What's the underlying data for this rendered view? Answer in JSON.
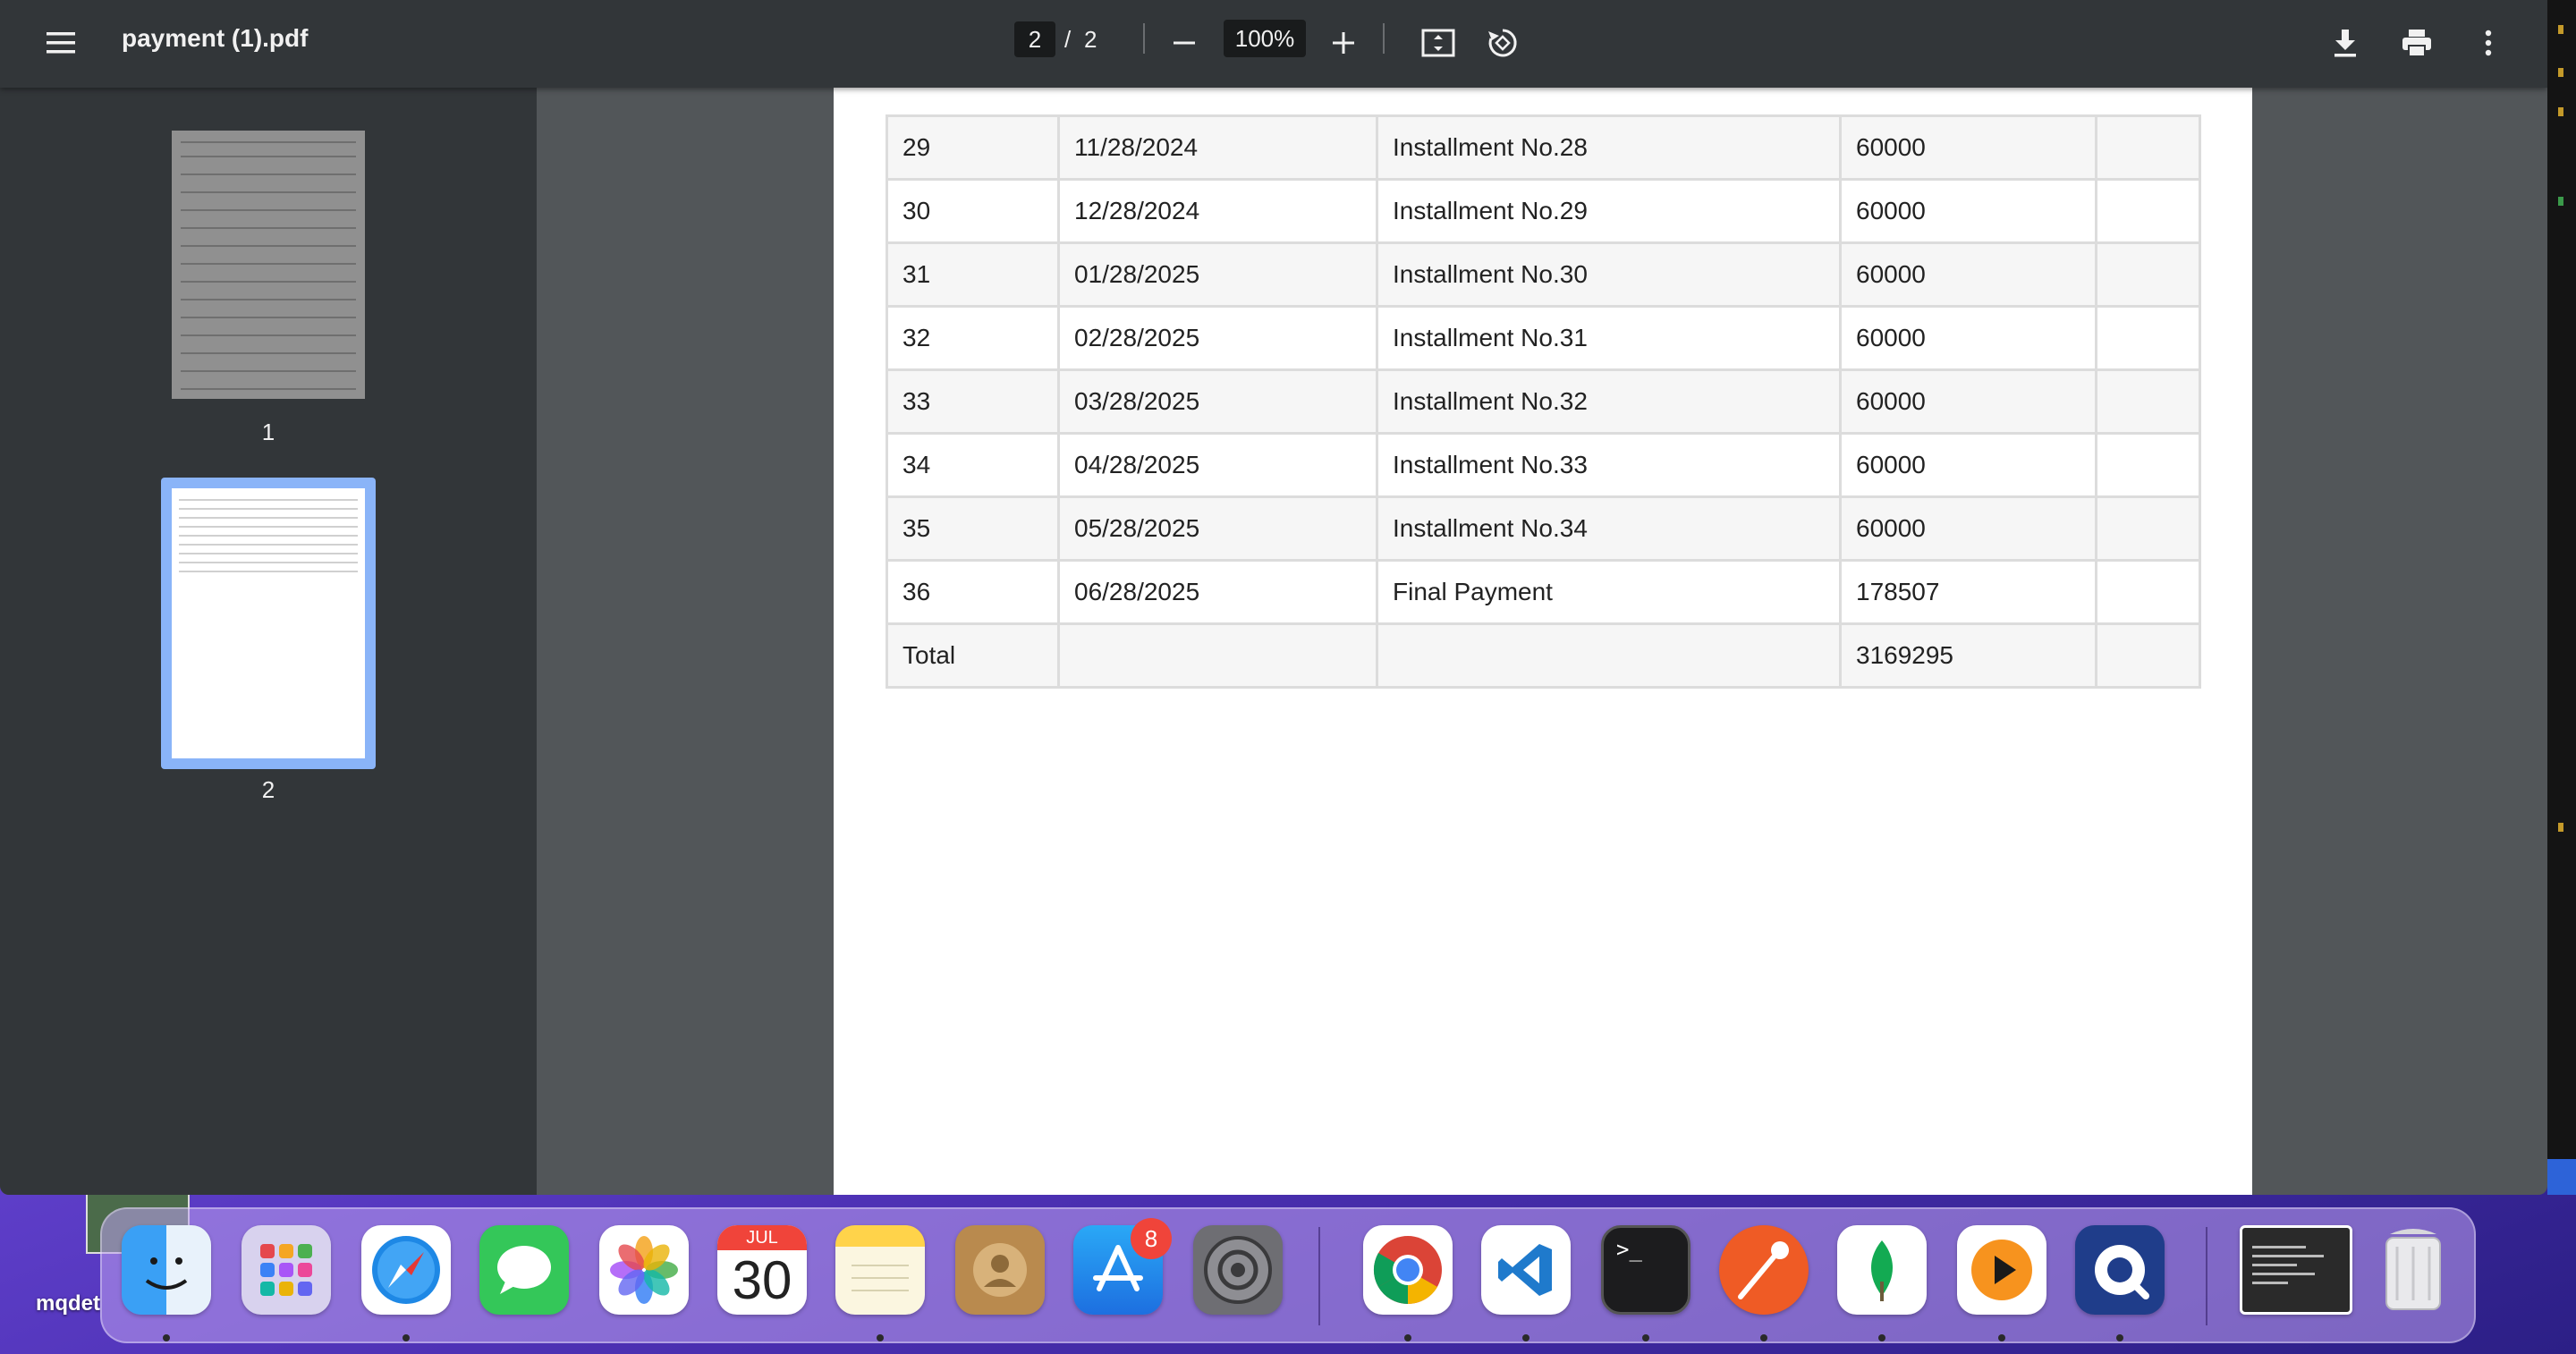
{
  "window": {
    "file_title": "payment (1).pdf",
    "current_page": "2",
    "page_separator": "/",
    "total_pages": "2",
    "zoom": "100%"
  },
  "sidebar": {
    "thumbnails": [
      {
        "label": "1",
        "selected": false
      },
      {
        "label": "2",
        "selected": true
      }
    ]
  },
  "table": {
    "rows": [
      {
        "no": "29",
        "date": "11/28/2024",
        "description": "Installment No.28",
        "amount": "60000",
        "extra": ""
      },
      {
        "no": "30",
        "date": "12/28/2024",
        "description": "Installment No.29",
        "amount": "60000",
        "extra": ""
      },
      {
        "no": "31",
        "date": "01/28/2025",
        "description": "Installment No.30",
        "amount": "60000",
        "extra": ""
      },
      {
        "no": "32",
        "date": "02/28/2025",
        "description": "Installment No.31",
        "amount": "60000",
        "extra": ""
      },
      {
        "no": "33",
        "date": "03/28/2025",
        "description": "Installment No.32",
        "amount": "60000",
        "extra": ""
      },
      {
        "no": "34",
        "date": "04/28/2025",
        "description": "Installment No.33",
        "amount": "60000",
        "extra": ""
      },
      {
        "no": "35",
        "date": "05/28/2025",
        "description": "Installment No.34",
        "amount": "60000",
        "extra": ""
      },
      {
        "no": "36",
        "date": "06/28/2025",
        "description": "Final Payment",
        "amount": "178507",
        "extra": ""
      },
      {
        "no": "Total",
        "date": "",
        "description": "",
        "amount": "3169295",
        "extra": ""
      }
    ]
  },
  "desktop": {
    "label": "mqdet"
  },
  "dock": {
    "calendar_month": "JUL",
    "calendar_day": "30",
    "app_store_badge": "8",
    "terminal_prompt": ">_",
    "apps": [
      "finder-icon",
      "launchpad-icon",
      "safari-icon",
      "messages-icon",
      "photos-icon",
      "calendar-icon",
      "notes-icon",
      "contacts-icon",
      "app-store-icon",
      "system-settings-icon",
      "chrome-icon",
      "vscode-icon",
      "terminal-icon",
      "postman-icon",
      "mongodb-compass-icon",
      "infuse-icon",
      "proxyman-icon",
      "window-preview-icon",
      "trash-icon"
    ]
  },
  "colors": {
    "toolbar_bg": "#323639",
    "viewer_bg": "#525659",
    "selected_thumb": "#8ab4f8",
    "badge_red": "#f0443a"
  }
}
